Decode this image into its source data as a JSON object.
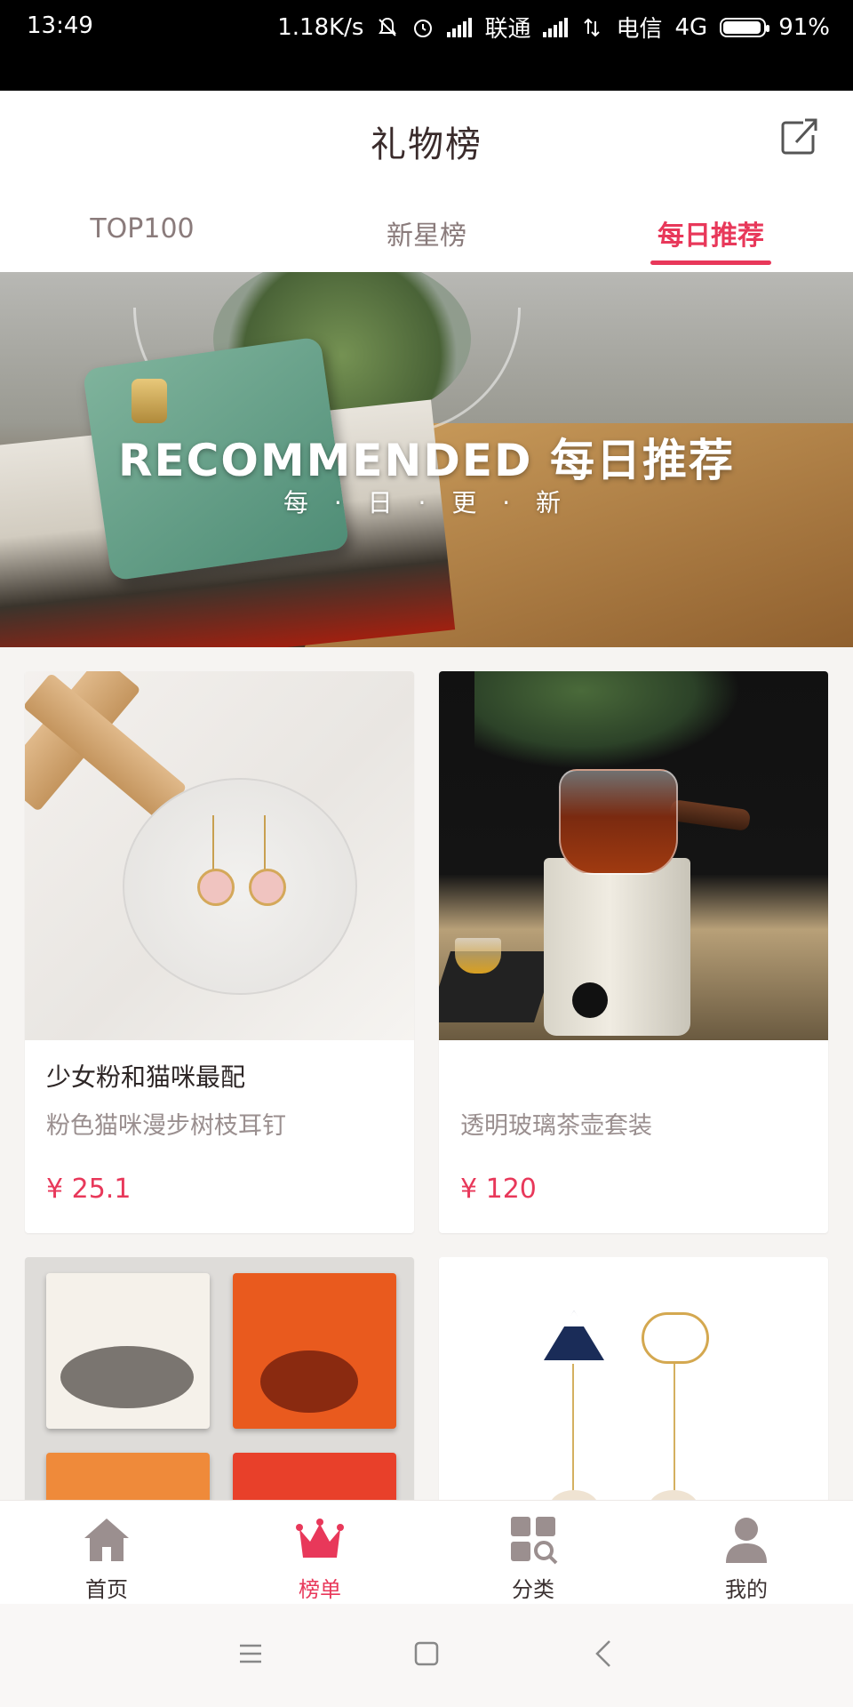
{
  "status_bar": {
    "time": "13:49",
    "speed": "1.18K/s",
    "carrier1": "联通",
    "carrier2": "电信",
    "network": "4G",
    "battery": "91%"
  },
  "header": {
    "title": "礼物榜",
    "share_icon": "share-icon"
  },
  "tabs": [
    {
      "label": "TOP100",
      "active": false
    },
    {
      "label": "新星榜",
      "active": false
    },
    {
      "label": "每日推荐",
      "active": true
    }
  ],
  "banner": {
    "title": "RECOMMENDED  每日推荐",
    "subtitle": "每 · 日 · 更 · 新"
  },
  "products": [
    {
      "tagline": "少女粉和猫咪最配",
      "name": "粉色猫咪漫步树枝耳钉",
      "price": "¥ 25.1"
    },
    {
      "tagline": "",
      "name": "透明玻璃茶壶套装",
      "price": "¥ 120"
    }
  ],
  "bottom_nav": [
    {
      "label": "首页",
      "icon": "home-icon",
      "active": false
    },
    {
      "label": "榜单",
      "icon": "crown-icon",
      "active": true
    },
    {
      "label": "分类",
      "icon": "category-icon",
      "active": false
    },
    {
      "label": "我的",
      "icon": "user-icon",
      "active": false
    }
  ],
  "colors": {
    "accent": "#e8385a",
    "tab_inactive": "#8a7b7b",
    "icon_inactive": "#9b8f8f"
  }
}
